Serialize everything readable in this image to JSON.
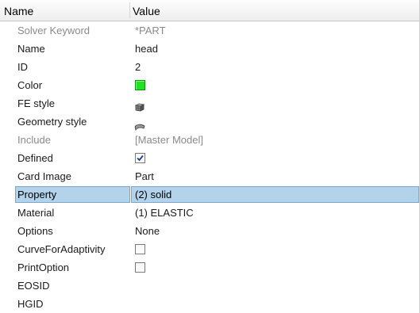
{
  "header": {
    "name_label": "Name",
    "value_label": "Value"
  },
  "rows": [
    {
      "name": "Solver Keyword",
      "value": "*PART",
      "state": "dim"
    },
    {
      "name": "Name",
      "value": "head"
    },
    {
      "name": "ID",
      "value": "2"
    },
    {
      "name": "Color",
      "value": "",
      "swatch_color": "#22e022"
    },
    {
      "name": "FE style",
      "value": "",
      "icon": "fe-style-icon"
    },
    {
      "name": "Geometry style",
      "value": "",
      "icon": "geometry-style-icon"
    },
    {
      "name": "Include",
      "value": "[Master Model]",
      "state": "dim"
    },
    {
      "name": "Defined",
      "value": "",
      "checked": true
    },
    {
      "name": "Card Image",
      "value": "Part"
    },
    {
      "name": "Property",
      "value": "(2) solid",
      "state": "selected"
    },
    {
      "name": "Material",
      "value": "(1) ELASTIC"
    },
    {
      "name": "Options",
      "value": "None"
    },
    {
      "name": "CurveForAdaptivity",
      "value": "",
      "checked": false
    },
    {
      "name": "PrintOption",
      "value": "",
      "checked": false
    },
    {
      "name": "EOSID",
      "value": ""
    },
    {
      "name": "HGID",
      "value": ""
    }
  ],
  "colors": {
    "selection_fill": "#b3d3ea",
    "selection_border": "#7aa8cc",
    "dim_text": "#8a8a8a",
    "part_color": "#22e022"
  }
}
